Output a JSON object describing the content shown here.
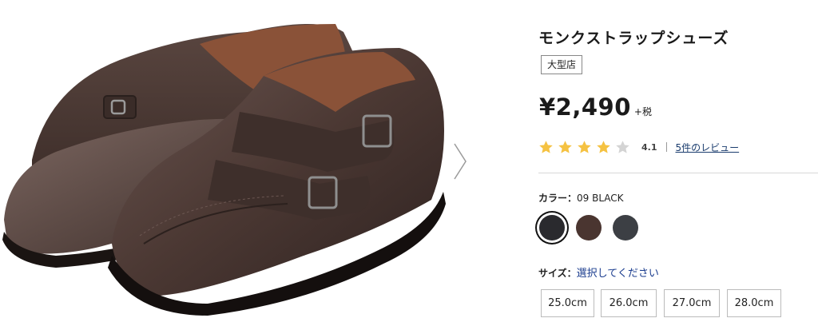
{
  "product": {
    "title": "モンクストラップシューズ",
    "badge": "大型店",
    "price": "¥2,490",
    "tax_suffix": "+税"
  },
  "rating": {
    "stars": 4,
    "max_stars": 5,
    "score": "4.1",
    "reviews_link": "5件のレビュー"
  },
  "color": {
    "label": "カラー：",
    "selected_value": "09 BLACK",
    "options": [
      {
        "name": "black",
        "hex": "#2a2a2e",
        "selected": true
      },
      {
        "name": "dark-brown",
        "hex": "#4a3530",
        "selected": false
      },
      {
        "name": "dark-gray",
        "hex": "#3c3f44",
        "selected": false
      }
    ]
  },
  "size": {
    "label": "サイズ：",
    "prompt": "選択してください",
    "options": [
      "25.0cm",
      "26.0cm",
      "27.0cm",
      "28.0cm"
    ]
  },
  "gallery": {
    "next_icon": "chevron-right-icon"
  },
  "colors": {
    "star_filled": "#f5c242",
    "star_empty": "#d4d4d4",
    "link": "#1a3c6e",
    "shoe_leather": "#4b3833",
    "shoe_lining": "#7a4a35"
  }
}
